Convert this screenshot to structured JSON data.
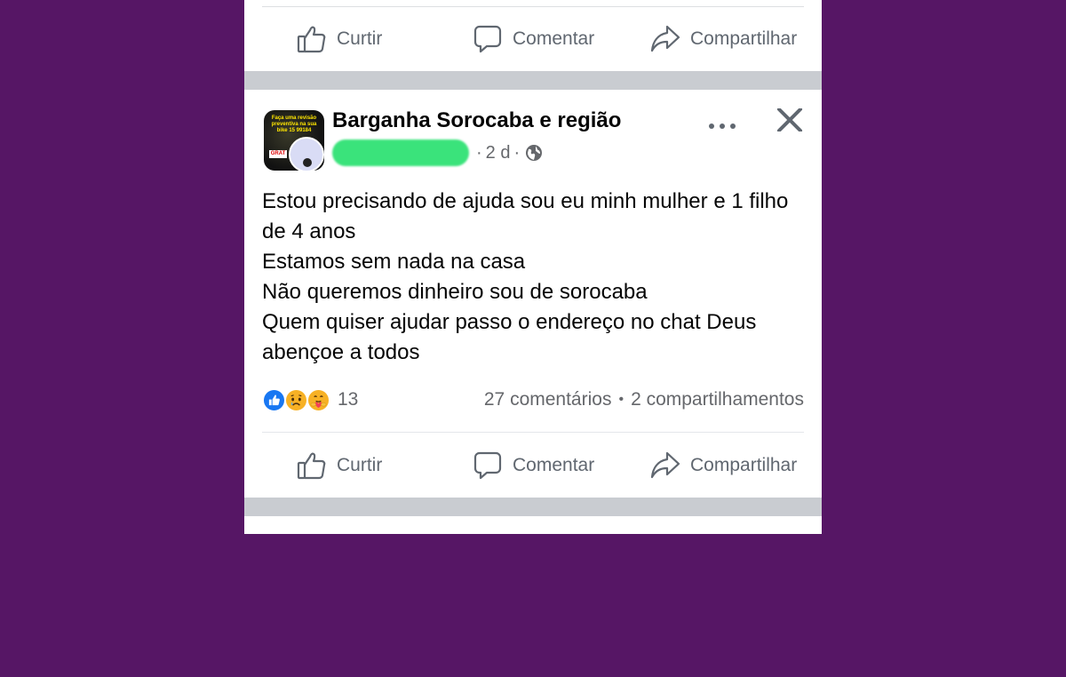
{
  "previous_post": {
    "actions": {
      "like_label": "Curtir",
      "comment_label": "Comentar",
      "share_label": "Compartilhar"
    }
  },
  "post": {
    "group_name": "Barganha Sorocaba e região",
    "time": "2 d",
    "meta_separator": "·",
    "privacy_icon": "globe-icon",
    "avatar_text": "Faça uma revisão preventiva na sua bike 15 99184",
    "avatar_badge": "GRAT",
    "body_lines": [
      "Estou precisando de ajuda sou eu minh mulher e 1 filho de 4 anos",
      "Estamos sem nada na casa",
      "Não queremos dinheiro sou de sorocaba",
      "Quem quiser ajudar passo o endereço no chat Deus abençoe a todos"
    ],
    "reactions": {
      "types": [
        "like",
        "sad",
        "care"
      ],
      "count": "13"
    },
    "comments": "27 comentários",
    "shares": "2 compartilhamentos",
    "stats_separator": "•",
    "actions": {
      "like_label": "Curtir",
      "comment_label": "Comentar",
      "share_label": "Compartilhar"
    }
  },
  "colors": {
    "background": "#561665",
    "card": "#ffffff",
    "separator": "#c9ccd1",
    "muted_text": "#65676b",
    "like_blue": "#1877f2",
    "redaction_green": "#3ae37b"
  }
}
